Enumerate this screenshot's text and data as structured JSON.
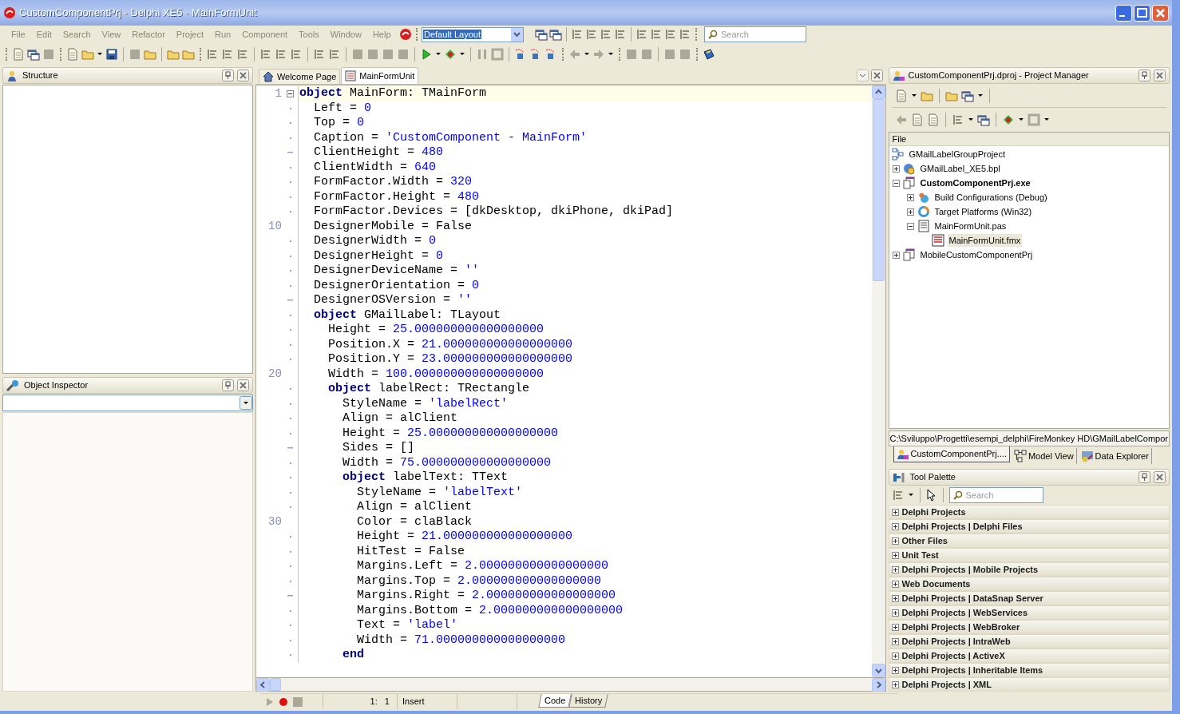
{
  "window": {
    "title": "CustomComponentPrj - Delphi XE5 - MainFormUnit"
  },
  "menu": [
    "File",
    "Edit",
    "Search",
    "View",
    "Refactor",
    "Project",
    "Run",
    "Component",
    "Tools",
    "Window",
    "Help"
  ],
  "layout_combo": {
    "value": "Default Layout"
  },
  "search": {
    "placeholder": "Search"
  },
  "structure_panel": {
    "title": "Structure"
  },
  "object_inspector": {
    "title": "Object Inspector"
  },
  "editor": {
    "tabs": [
      {
        "label": "Welcome Page",
        "selected": false,
        "kind": "home"
      },
      {
        "label": "MainFormUnit",
        "selected": true,
        "kind": "form"
      }
    ],
    "lines": [
      {
        "number": "1",
        "kind": "fold",
        "current": true,
        "parts": [
          {
            "kind": "keyword",
            "text": "object"
          },
          {
            "kind": "plain",
            "text": " MainForm: TMainForm"
          }
        ]
      },
      {
        "kind": "dot",
        "current": false,
        "parts": [
          {
            "kind": "plain",
            "text": "  Left = "
          },
          {
            "kind": "value",
            "text": "0"
          }
        ]
      },
      {
        "kind": "dot",
        "current": false,
        "parts": [
          {
            "kind": "plain",
            "text": "  Top = "
          },
          {
            "kind": "value",
            "text": "0"
          }
        ]
      },
      {
        "kind": "dot",
        "current": false,
        "parts": [
          {
            "kind": "plain",
            "text": "  Caption = "
          },
          {
            "kind": "value",
            "text": "'CustomComponent - MainForm'"
          }
        ]
      },
      {
        "kind": "dash",
        "current": false,
        "parts": [
          {
            "kind": "plain",
            "text": "  ClientHeight = "
          },
          {
            "kind": "value",
            "text": "480"
          }
        ]
      },
      {
        "kind": "dot",
        "current": false,
        "parts": [
          {
            "kind": "plain",
            "text": "  ClientWidth = "
          },
          {
            "kind": "value",
            "text": "640"
          }
        ]
      },
      {
        "kind": "dot",
        "current": false,
        "parts": [
          {
            "kind": "plain",
            "text": "  FormFactor.Width = "
          },
          {
            "kind": "value",
            "text": "320"
          }
        ]
      },
      {
        "kind": "dot",
        "current": false,
        "parts": [
          {
            "kind": "plain",
            "text": "  FormFactor.Height = "
          },
          {
            "kind": "value",
            "text": "480"
          }
        ]
      },
      {
        "kind": "dot",
        "current": false,
        "parts": [
          {
            "kind": "plain",
            "text": "  FormFactor.Devices = [dkDesktop, dkiPhone, dkiPad]"
          }
        ]
      },
      {
        "number": "10",
        "kind": "number",
        "current": false,
        "parts": [
          {
            "kind": "plain",
            "text": "  DesignerMobile = False"
          }
        ]
      },
      {
        "kind": "dot",
        "current": false,
        "parts": [
          {
            "kind": "plain",
            "text": "  DesignerWidth = "
          },
          {
            "kind": "value",
            "text": "0"
          }
        ]
      },
      {
        "kind": "dot",
        "current": false,
        "parts": [
          {
            "kind": "plain",
            "text": "  DesignerHeight = "
          },
          {
            "kind": "value",
            "text": "0"
          }
        ]
      },
      {
        "kind": "dot",
        "current": false,
        "parts": [
          {
            "kind": "plain",
            "text": "  DesignerDeviceName = "
          },
          {
            "kind": "value",
            "text": "''"
          }
        ]
      },
      {
        "kind": "dot",
        "current": false,
        "parts": [
          {
            "kind": "plain",
            "text": "  DesignerOrientation = "
          },
          {
            "kind": "value",
            "text": "0"
          }
        ]
      },
      {
        "kind": "dash",
        "current": false,
        "parts": [
          {
            "kind": "plain",
            "text": "  DesignerOSVersion = "
          },
          {
            "kind": "value",
            "text": "''"
          }
        ]
      },
      {
        "kind": "dot",
        "current": false,
        "parts": [
          {
            "kind": "keyword",
            "text": "  object"
          },
          {
            "kind": "plain",
            "text": " GMailLabel: TLayout"
          }
        ]
      },
      {
        "kind": "dot",
        "current": false,
        "parts": [
          {
            "kind": "plain",
            "text": "    Height = "
          },
          {
            "kind": "value",
            "text": "25.000000000000000000"
          }
        ]
      },
      {
        "kind": "dot",
        "current": false,
        "parts": [
          {
            "kind": "plain",
            "text": "    Position.X = "
          },
          {
            "kind": "value",
            "text": "21.000000000000000000"
          }
        ]
      },
      {
        "kind": "dot",
        "current": false,
        "parts": [
          {
            "kind": "plain",
            "text": "    Position.Y = "
          },
          {
            "kind": "value",
            "text": "23.000000000000000000"
          }
        ]
      },
      {
        "number": "20",
        "kind": "number",
        "current": false,
        "parts": [
          {
            "kind": "plain",
            "text": "    Width = "
          },
          {
            "kind": "value",
            "text": "100.000000000000000000"
          }
        ]
      },
      {
        "kind": "dot",
        "current": false,
        "parts": [
          {
            "kind": "keyword",
            "text": "    object"
          },
          {
            "kind": "plain",
            "text": " labelRect: TRectangle"
          }
        ]
      },
      {
        "kind": "dot",
        "current": false,
        "parts": [
          {
            "kind": "plain",
            "text": "      StyleName = "
          },
          {
            "kind": "value",
            "text": "'labelRect'"
          }
        ]
      },
      {
        "kind": "dot",
        "current": false,
        "parts": [
          {
            "kind": "plain",
            "text": "      Align = alClient"
          }
        ]
      },
      {
        "kind": "dot",
        "current": false,
        "parts": [
          {
            "kind": "plain",
            "text": "      Height = "
          },
          {
            "kind": "value",
            "text": "25.000000000000000000"
          }
        ]
      },
      {
        "kind": "dash",
        "current": false,
        "parts": [
          {
            "kind": "plain",
            "text": "      Sides = []"
          }
        ]
      },
      {
        "kind": "dot",
        "current": false,
        "parts": [
          {
            "kind": "plain",
            "text": "      Width = "
          },
          {
            "kind": "value",
            "text": "75.000000000000000000"
          }
        ]
      },
      {
        "kind": "dot",
        "current": false,
        "parts": [
          {
            "kind": "keyword",
            "text": "      object"
          },
          {
            "kind": "plain",
            "text": " labelText: TText"
          }
        ]
      },
      {
        "kind": "dot",
        "current": false,
        "parts": [
          {
            "kind": "plain",
            "text": "        StyleName = "
          },
          {
            "kind": "value",
            "text": "'labelText'"
          }
        ]
      },
      {
        "kind": "dot",
        "current": false,
        "parts": [
          {
            "kind": "plain",
            "text": "        Align = alClient"
          }
        ]
      },
      {
        "number": "30",
        "kind": "number",
        "current": false,
        "parts": [
          {
            "kind": "plain",
            "text": "        Color = claBlack"
          }
        ]
      },
      {
        "kind": "dot",
        "current": false,
        "parts": [
          {
            "kind": "plain",
            "text": "        Height = "
          },
          {
            "kind": "value",
            "text": "21.000000000000000000"
          }
        ]
      },
      {
        "kind": "dot",
        "current": false,
        "parts": [
          {
            "kind": "plain",
            "text": "        HitTest = False"
          }
        ]
      },
      {
        "kind": "dot",
        "current": false,
        "parts": [
          {
            "kind": "plain",
            "text": "        Margins.Left = "
          },
          {
            "kind": "value",
            "text": "2.000000000000000000"
          }
        ]
      },
      {
        "kind": "dot",
        "current": false,
        "parts": [
          {
            "kind": "plain",
            "text": "        Margins.Top = "
          },
          {
            "kind": "value",
            "text": "2.000000000000000000"
          }
        ]
      },
      {
        "kind": "dash",
        "current": false,
        "parts": [
          {
            "kind": "plain",
            "text": "        Margins.Right = "
          },
          {
            "kind": "value",
            "text": "2.000000000000000000"
          }
        ]
      },
      {
        "kind": "dot",
        "current": false,
        "parts": [
          {
            "kind": "plain",
            "text": "        Margins.Bottom = "
          },
          {
            "kind": "value",
            "text": "2.000000000000000000"
          }
        ]
      },
      {
        "kind": "dot",
        "current": false,
        "parts": [
          {
            "kind": "plain",
            "text": "        Text = "
          },
          {
            "kind": "value",
            "text": "'label'"
          }
        ]
      },
      {
        "kind": "dot",
        "current": false,
        "parts": [
          {
            "kind": "plain",
            "text": "        Width = "
          },
          {
            "kind": "value",
            "text": "71.000000000000000000"
          }
        ]
      },
      {
        "kind": "dot",
        "current": false,
        "parts": [
          {
            "kind": "keyword",
            "text": "      end"
          }
        ]
      }
    ],
    "status": {
      "position": "1:   1",
      "mode": "Insert"
    },
    "bottom_tabs": [
      {
        "label": "Code",
        "selected": true
      },
      {
        "label": "History",
        "selected": false
      }
    ]
  },
  "project_manager": {
    "title": "CustomComponentPrj.dproj - Project Manager",
    "column": "File",
    "tree": [
      {
        "label": "GMailLabelGroupProject",
        "kind": "group",
        "expandable": false,
        "active": false,
        "selected": false,
        "children": [
          {
            "label": "GMailLabel_XE5.bpl",
            "kind": "package",
            "expandable": true,
            "expanded": false,
            "active": false,
            "selected": false
          },
          {
            "label": "CustomComponentPrj.exe",
            "kind": "project",
            "expandable": true,
            "expanded": true,
            "active": true,
            "selected": false,
            "children": [
              {
                "label": "Build Configurations (Debug)",
                "kind": "config",
                "expandable": true,
                "expanded": false,
                "active": false,
                "selected": false
              },
              {
                "label": "Target Platforms (Win32)",
                "kind": "platform",
                "expandable": true,
                "expanded": false,
                "active": false,
                "selected": false
              },
              {
                "label": "MainFormUnit.pas",
                "kind": "unit",
                "expandable": true,
                "expanded": true,
                "active": false,
                "selected": false,
                "children": [
                  {
                    "label": "MainFormUnit.fmx",
                    "kind": "form",
                    "expandable": false,
                    "active": false,
                    "selected": true
                  }
                ]
              }
            ]
          },
          {
            "label": "MobileCustomComponentPrj",
            "kind": "project",
            "expandable": true,
            "expanded": false,
            "active": false,
            "selected": false
          }
        ]
      }
    ],
    "path": "C:\\Sviluppo\\Progetti\\esempi_delphi\\FireMonkey HD\\GMailLabelCompor",
    "tabs": [
      {
        "label": "CustomComponentPrj....",
        "selected": true,
        "kind": "project"
      },
      {
        "label": "Model View",
        "selected": false,
        "kind": "model"
      },
      {
        "label": "Data Explorer",
        "selected": false,
        "kind": "data"
      }
    ]
  },
  "tool_palette": {
    "title": "Tool Palette",
    "search": {
      "placeholder": "Search"
    },
    "categories": [
      {
        "label": "Delphi Projects",
        "expanded": false
      },
      {
        "label": "Delphi Projects | Delphi Files",
        "expanded": false
      },
      {
        "label": "Other Files",
        "expanded": false
      },
      {
        "label": "Unit Test",
        "expanded": false
      },
      {
        "label": "Delphi Projects | Mobile Projects",
        "expanded": false
      },
      {
        "label": "Web Documents",
        "expanded": false
      },
      {
        "label": "Delphi Projects | DataSnap Server",
        "expanded": false
      },
      {
        "label": "Delphi Projects | WebServices",
        "expanded": false
      },
      {
        "label": "Delphi Projects | WebBroker",
        "expanded": false
      },
      {
        "label": "Delphi Projects | IntraWeb",
        "expanded": false
      },
      {
        "label": "Delphi Projects | ActiveX",
        "expanded": false
      },
      {
        "label": "Delphi Projects | Inheritable Items",
        "expanded": false
      },
      {
        "label": "Delphi Projects | XML",
        "expanded": false
      }
    ]
  }
}
